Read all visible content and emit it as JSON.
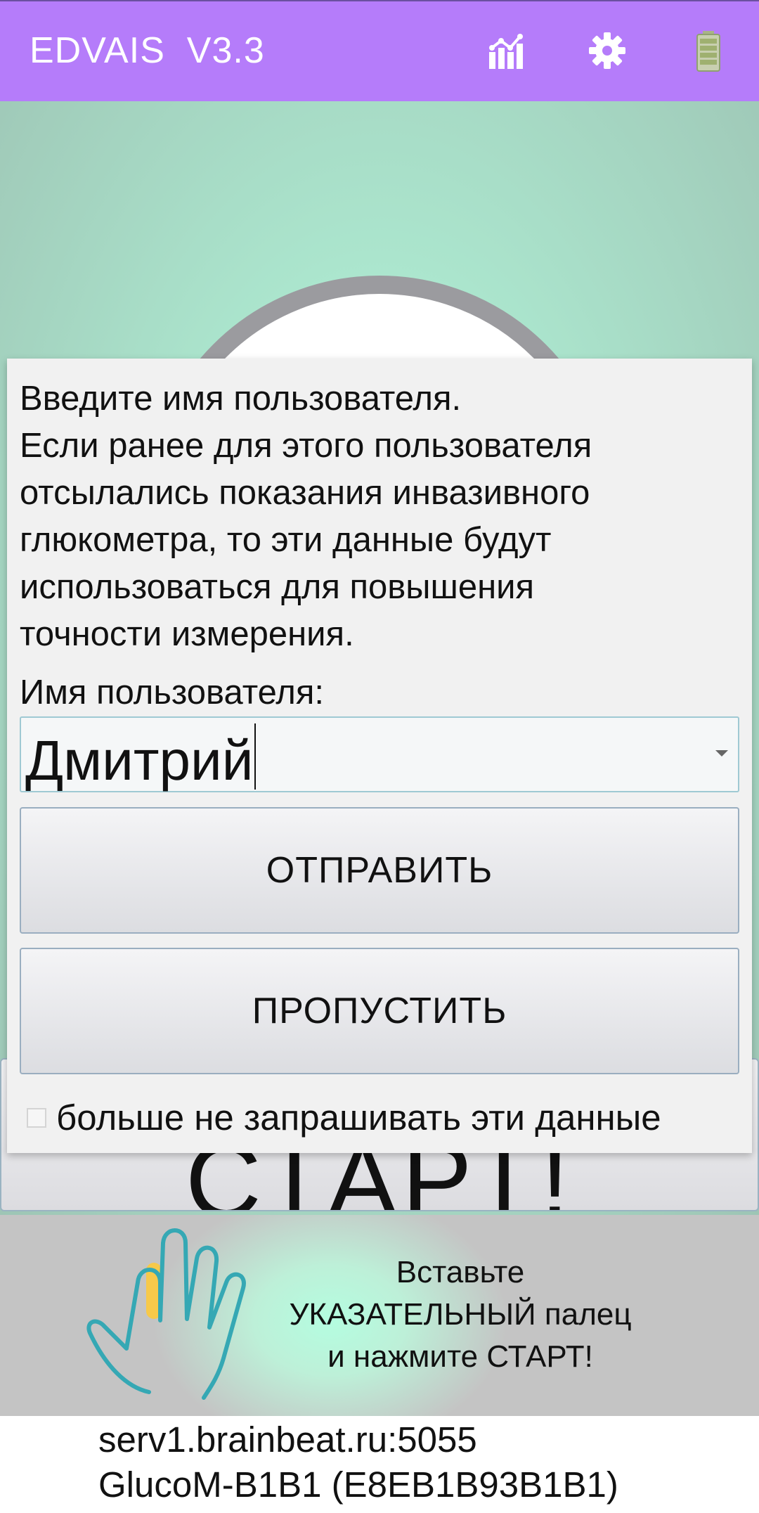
{
  "appbar": {
    "title": "EDVAIS  V3.3",
    "icons": [
      "bar-chart-icon",
      "gear-icon",
      "battery-icon"
    ],
    "background": "#b57cfa"
  },
  "main": {
    "start_label": "СТАРТ!"
  },
  "dialog": {
    "message_lines": [
      "Введите имя пользователя.",
      "Если ранее для этого пользователя",
      "отсылались показания инвазивного",
      "глюкометра, то эти данные будут",
      "использоваться для повышения",
      "точности измерения."
    ],
    "username_label": "Имя пользователя:",
    "username_value": "Дмитрий",
    "send_label": "ОТПРАВИТЬ",
    "skip_label": "ПРОПУСТИТЬ",
    "dont_ask_label": "больше не запрашивать эти данные",
    "dont_ask_checked": false
  },
  "instruction": {
    "lines": [
      "Вставьте",
      "УКАЗАТЕЛЬНЫЙ палец",
      "и нажмите СТАРТ!"
    ],
    "highlight_color": "#f7c94a",
    "hand_outline_color": "#35a8b4"
  },
  "footer": {
    "server": "serv1.brainbeat.ru:5055",
    "device": "GlucoM-B1B1 (E8EB1B93B1B1)"
  }
}
